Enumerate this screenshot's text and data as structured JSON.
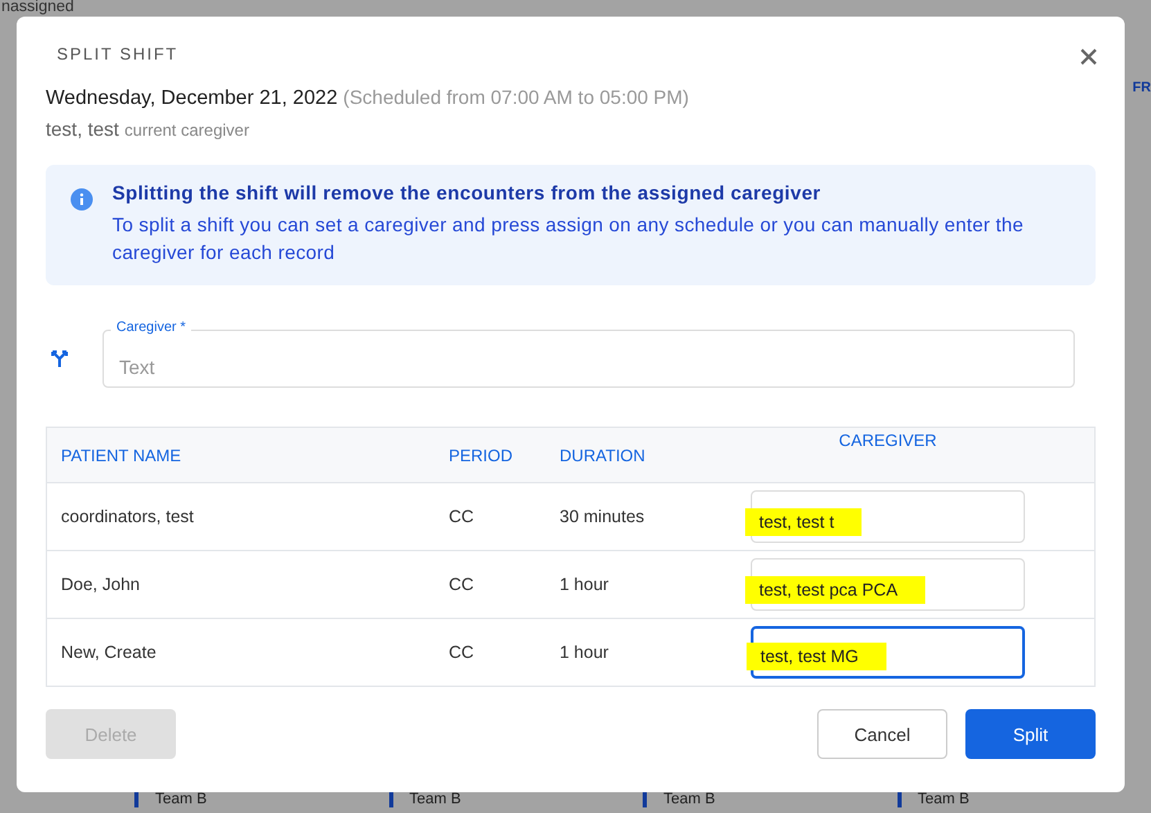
{
  "background": {
    "top_left": [
      "nassigned"
    ],
    "right_column": [
      "FR"
    ],
    "bottom_labels": [
      "Team B",
      "Team B",
      "Team B",
      "Team B"
    ]
  },
  "dialog": {
    "title": "SPLIT SHIFT",
    "date": "Wednesday, December 21, 2022",
    "scheduled": "(Scheduled from 07:00 AM to 05:00 PM)",
    "caregiver_name": "test, test",
    "caregiver_note": "current caregiver",
    "alert": {
      "title": "Splitting the shift will remove the encounters from the assigned caregiver",
      "text": "To split a shift you can set a caregiver and press assign on any schedule or you can manually enter the caregiver for each record"
    },
    "caregiver_field": {
      "label": "Caregiver *",
      "placeholder": "Text"
    },
    "table": {
      "columns": [
        "PATIENT NAME",
        "PERIOD",
        "DURATION",
        "CAREGIVER"
      ],
      "rows": [
        {
          "patient": "coordinators, test",
          "period": "CC",
          "duration": "30 minutes",
          "caregiver": "test, test  t",
          "focused": false
        },
        {
          "patient": "Doe, John",
          "period": "CC",
          "duration": "1 hour",
          "caregiver": "test, test pca PCA",
          "focused": false
        },
        {
          "patient": "New, Create",
          "period": "CC",
          "duration": "1 hour",
          "caregiver": "test, test MG",
          "focused": true
        }
      ]
    },
    "buttons": [
      {
        "label": "Delete",
        "kind": "secondary",
        "disabled": true
      },
      {
        "label": "Cancel",
        "kind": "outline",
        "disabled": false
      },
      {
        "label": "Split",
        "kind": "primary",
        "disabled": false
      }
    ]
  }
}
